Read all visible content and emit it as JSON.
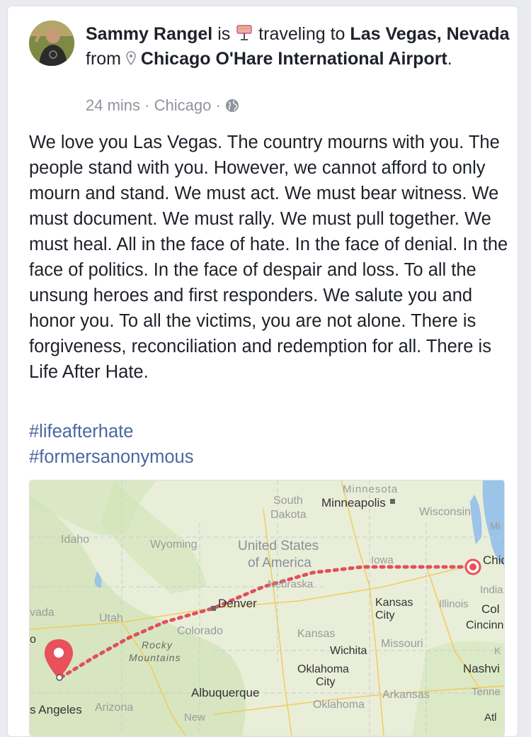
{
  "post": {
    "author": "Sammy Rangel",
    "is": "is",
    "activity": "traveling to",
    "destination": "Las Vegas, Nevada",
    "from": "from",
    "origin": "Chicago O'Hare International Airport",
    "period": ".",
    "time": "24 mins",
    "separator": "·",
    "location": "Chicago",
    "separator2": "·",
    "privacy_icon": "globe-icon",
    "text": "We love you Las Vegas. The country mourns with you. The people stand with you. However, we cannot afford to only mourn and stand. We must act. We must bear witness. We must document. We must rally. We must pull together. We must heal. All in the face of hate. In the face of denial. In the face of politics. In the face of despair and loss. To all the unsung heroes and first responders. We salute you and honor you. To all the victims, you are not alone. There is forgiveness, reconciliation and redemption for all. There is Life After Hate.",
    "hashtags": [
      "#lifeafterhate",
      "#formersanonymous"
    ]
  },
  "map": {
    "labels": {
      "minnesota": "Minnesota",
      "south_dakota_1": "South",
      "south_dakota_2": "Dakota",
      "minneapolis": "Minneapolis",
      "wisconsin": "Wisconsin",
      "mi": "Mi",
      "idaho": "Idaho",
      "wyoming": "Wyoming",
      "us_1": "United States",
      "us_2": "of America",
      "iowa": "Iowa",
      "chicago": "Chic",
      "nebraska": "Nebraska",
      "india": "India",
      "illinois": "Illinois",
      "vada": "vada",
      "utah": "Utah",
      "denver": "Denver",
      "kansas_city_1": "Kansas",
      "kansas_city_2": "City",
      "col": "Col",
      "colorado": "Colorado",
      "cincinnati": "Cincinn",
      "o": "o",
      "kansas": "Kansas",
      "rocky_1": "Rocky",
      "rocky_2": "Mountains",
      "wichita": "Wichita",
      "missouri": "Missouri",
      "k": "K",
      "oklahoma_city_1": "Oklahoma",
      "oklahoma_city_2": "City",
      "nashville": "Nashvi",
      "tenne": "Tenne",
      "albuquerque": "Albuquerque",
      "arkansas": "Arkansas",
      "los_angeles": "s Angeles",
      "arizona": "Arizona",
      "oklahoma": "Oklahoma",
      "new": "New",
      "atl": "Atl"
    },
    "colors": {
      "route": "#e0505a",
      "pin": "#e8505a",
      "land": "#e8edd8",
      "water": "#9cc3e8"
    }
  }
}
